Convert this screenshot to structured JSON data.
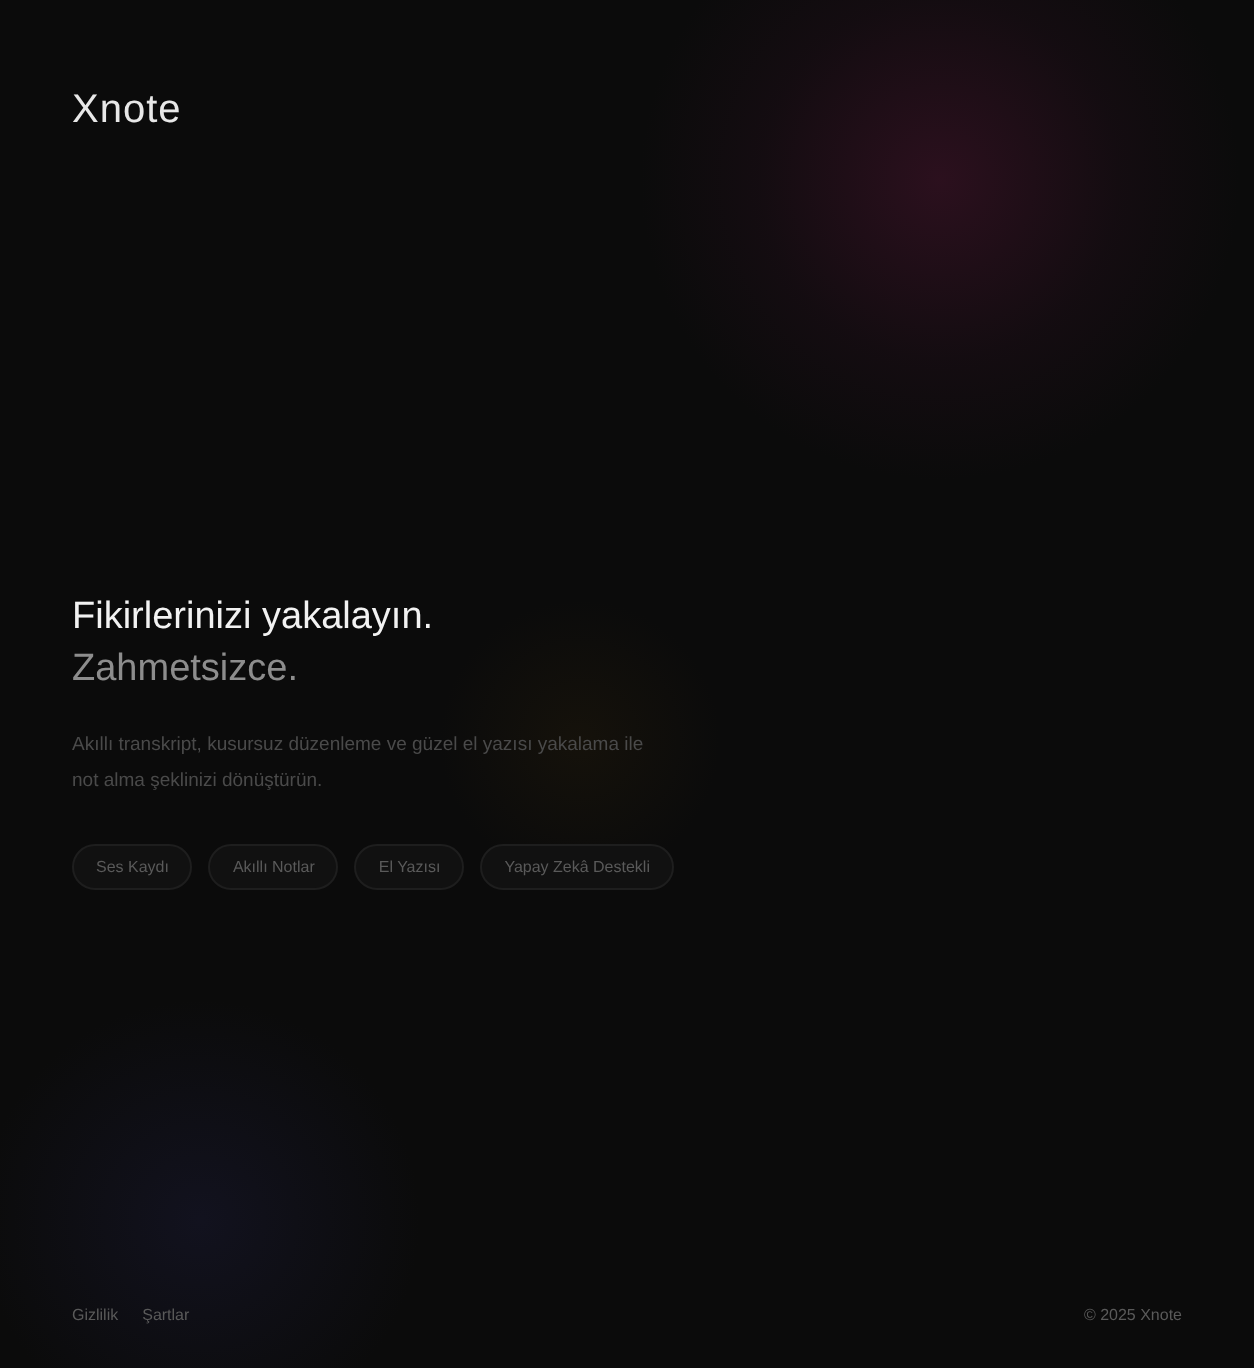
{
  "logo": "Xnote",
  "hero": {
    "title": "Fikirlerinizi yakalayın.",
    "subtitle": "Zahmetsizce.",
    "description": "Akıllı transkript, kusursuz düzenleme ve güzel el yazısı yakalama ile not alma şeklinizi dönüştürün."
  },
  "features": [
    "Ses Kaydı",
    "Akıllı Notlar",
    "El Yazısı",
    "Yapay Zekâ Destekli"
  ],
  "footer": {
    "links": [
      "Gizlilik",
      "Şartlar"
    ],
    "copyright": "© 2025 Xnote"
  }
}
